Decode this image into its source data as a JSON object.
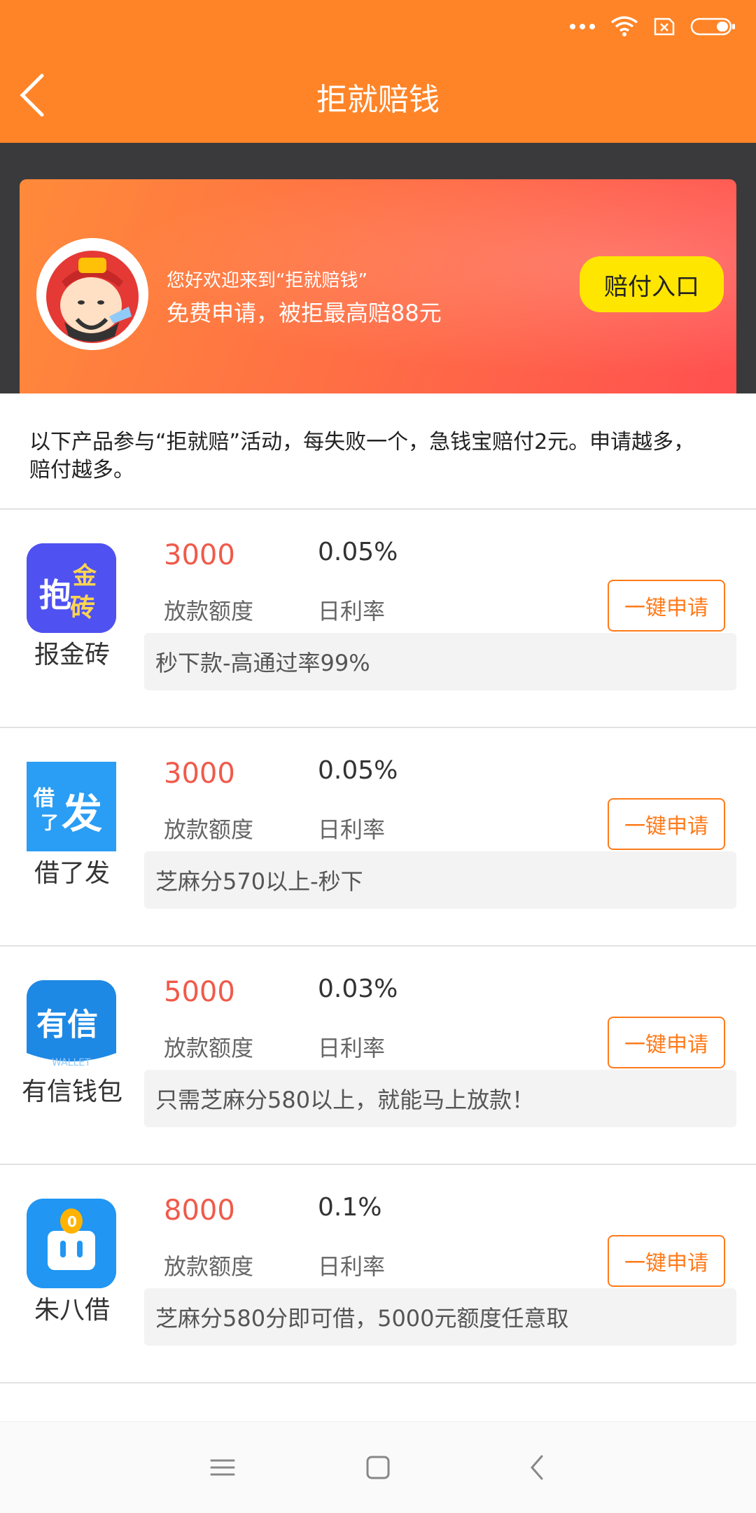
{
  "header": {
    "title": "拒就赔钱"
  },
  "banner": {
    "welcome": "您好欢迎来到“拒就赔钱”",
    "subtitle": "免费申请，被拒最高赔88元",
    "button_label": "赔付入口"
  },
  "notice": "以下产品参与“拒就赔”活动，每失败一个，急钱宝赔付2元。申请越多，赔付越多。",
  "labels": {
    "amount_label": "放款额度",
    "rate_label": "日利率",
    "apply_label": "一键申请"
  },
  "products": [
    {
      "name": "报金砖",
      "amount": "3000",
      "rate": "0.05%",
      "desc": "秒下款-高通过率99%",
      "icon_text": "抱金砖"
    },
    {
      "name": "借了发",
      "amount": "3000",
      "rate": "0.05%",
      "desc": "芝麻分570以上-秒下",
      "icon_text": "借了发"
    },
    {
      "name": "有信钱包",
      "amount": "5000",
      "rate": "0.03%",
      "desc": "只需芝麻分580以上，就能马上放款！",
      "icon_text": "有信",
      "icon_subtext": "WALLET"
    },
    {
      "name": "朱八借",
      "amount": "8000",
      "rate": "0.1%",
      "desc": "芝麻分580分即可借，5000元额度任意取"
    }
  ],
  "colors": {
    "brand_orange": "#ff8427",
    "amount_red": "#f05a4a",
    "claim_yellow": "#ffe600"
  },
  "icons": {
    "back": "chevron-left-icon",
    "status": [
      "more-dots-icon",
      "wifi-icon",
      "no-sim-icon",
      "battery-icon"
    ],
    "nav": [
      "menu-icon",
      "home-icon",
      "back-icon"
    ]
  }
}
